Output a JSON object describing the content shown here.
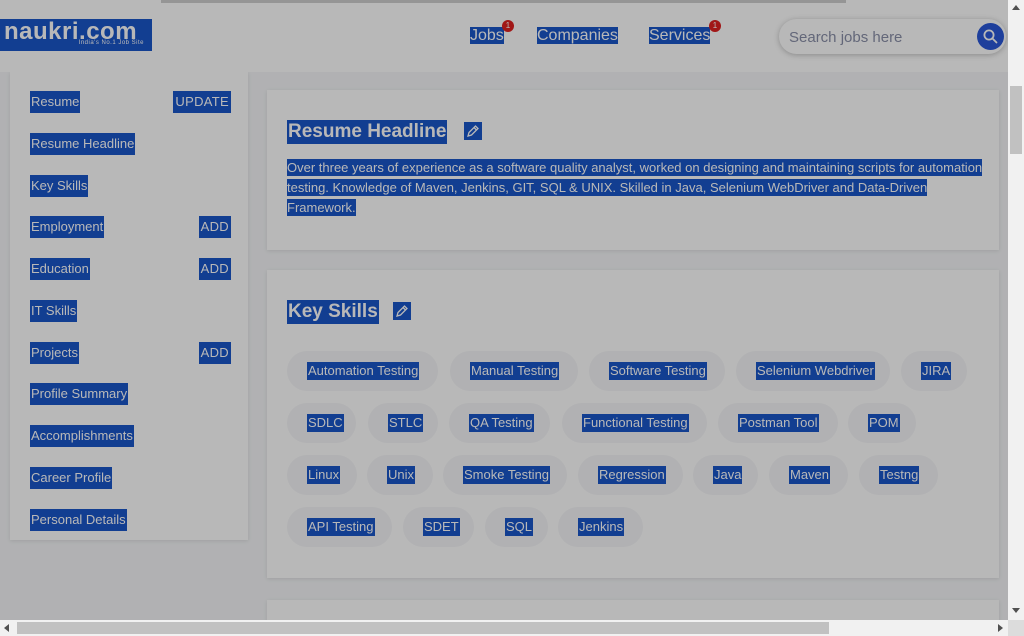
{
  "header": {
    "logo": {
      "word": "naukri.com",
      "tagline": "India's No.1 Job Site"
    },
    "nav": [
      {
        "label": "Jobs",
        "badge": "1"
      },
      {
        "label": "Companies"
      },
      {
        "label": "Services",
        "badge": "1"
      }
    ],
    "search": {
      "placeholder": "Search jobs here",
      "icon": "search-icon"
    }
  },
  "sidebar": {
    "items": [
      {
        "label": "Resume",
        "action": "UPDATE"
      },
      {
        "label": "Resume Headline"
      },
      {
        "label": "Key Skills"
      },
      {
        "label": "Employment",
        "action": "ADD"
      },
      {
        "label": "Education",
        "action": "ADD"
      },
      {
        "label": "IT Skills"
      },
      {
        "label": "Projects",
        "action": "ADD"
      },
      {
        "label": "Profile Summary"
      },
      {
        "label": "Accomplishments"
      },
      {
        "label": "Career Profile"
      },
      {
        "label": "Personal Details"
      }
    ]
  },
  "headline_card": {
    "title": "Resume Headline",
    "edit_icon": "pencil-icon",
    "text": "Over three years of experience as a software quality analyst, worked on designing and maintaining scripts for automation testing. Knowledge of Maven, Jenkins, GIT, SQL & UNIX. Skilled in Java, Selenium WebDriver and Data-Driven Framework."
  },
  "skills_card": {
    "title": "Key Skills",
    "edit_icon": "pencil-icon",
    "skills": [
      "Automation Testing",
      "Manual Testing",
      "Software Testing",
      "Selenium Webdriver",
      "JIRA",
      "SDLC",
      "STLC",
      "QA Testing",
      "Functional Testing",
      "Postman Tool",
      "POM",
      "Linux",
      "Unix",
      "Smoke Testing",
      "Regression",
      "Java",
      "Maven",
      "Testng",
      "API Testing",
      "SDET",
      "SQL",
      "Jenkins"
    ]
  },
  "colors": {
    "selection": "#1a56c9",
    "accent": "#2a58d8",
    "badge": "#e02020",
    "text": "#474d6a"
  }
}
